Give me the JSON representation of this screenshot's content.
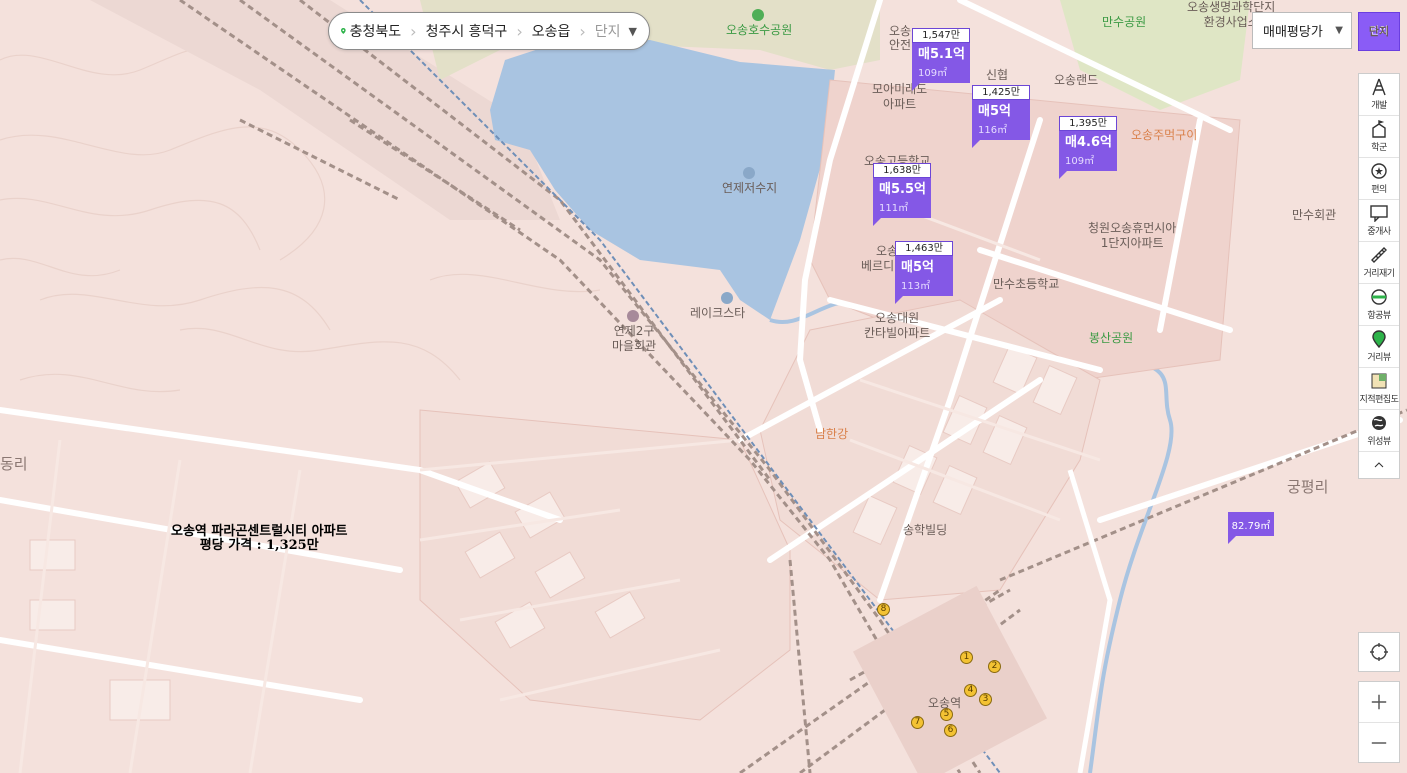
{
  "breadcrumb": {
    "items": [
      "충청북도",
      "청주시 흥덕구",
      "오송읍"
    ],
    "current": "단지"
  },
  "price_type_select": {
    "selected": "매매평당가"
  },
  "complex_button": {
    "top": "편의",
    "label": "단지"
  },
  "toolbar": [
    {
      "label": "개발",
      "icon": "development-icon"
    },
    {
      "label": "학군",
      "icon": "school-district-icon"
    },
    {
      "label": "편의",
      "icon": "convenience-icon"
    },
    {
      "label": "중개사",
      "icon": "realtor-icon"
    },
    {
      "label": "거리재기",
      "icon": "ruler-icon"
    },
    {
      "label": "항공뷰",
      "icon": "aerial-view-icon"
    },
    {
      "label": "거리뷰",
      "icon": "street-view-icon"
    },
    {
      "label": "지적편집도",
      "icon": "cadastral-map-icon"
    },
    {
      "label": "위성뷰",
      "icon": "satellite-view-icon"
    }
  ],
  "markers": [
    {
      "ppa": "1,547만",
      "price": "매5.1억",
      "area": "109㎡"
    },
    {
      "ppa": "1,425만",
      "price": "매5억",
      "area": "116㎡"
    },
    {
      "ppa": "1,395만",
      "price": "매4.6억",
      "area": "109㎡"
    },
    {
      "ppa": "1,638만",
      "price": "매5.5억",
      "area": "111㎡"
    },
    {
      "ppa": "1,463만",
      "price": "매5억",
      "area": "113㎡"
    }
  ],
  "small_marker": {
    "area": "82.79㎡"
  },
  "labels": {
    "osong_lake_park": "오송호수공원",
    "yeonje_reservoir": "연제저수지",
    "lakestar": "레이크스타",
    "yeonje2gu": "연제2구",
    "maeul_hall": "마을회관",
    "moa_1": "모아미래도",
    "moa_2": "아파트",
    "anjeon_frag": "안전",
    "osong_frag": "오송",
    "sinhyeop": "신협",
    "osong_land": "오송랜드",
    "hs_frag": "오송고등학교",
    "osong_ju": "오송주먹구이",
    "manshu_park": "만수공원",
    "manshu_hall": "만수회관",
    "saengmyeong_1": "오송생명과학단지",
    "saengmyeong_2": "환경사업소",
    "hueman_1": "청원오송휴먼시아",
    "hueman_2": "1단지아파트",
    "berdi_frag": "오송",
    "berdi_frag2": "베르디",
    "manshu_school": "만수초등학교",
    "bongsan_park": "봉산공원",
    "daewon_1": "오송대원",
    "daewon_2": "칸타빌아파트",
    "namhangang": "남한강",
    "songhak": "송학빌딩",
    "gungpyeong": "궁평리",
    "ri_left": "동리",
    "osong_station": "오송역"
  },
  "overlay_note": {
    "line1": "오송역 파라곤센트럴시티 아파트",
    "line2": "평당 가격 : 1,325만"
  },
  "station_exits": [
    "1",
    "2",
    "3",
    "4",
    "5",
    "6",
    "7",
    "8"
  ],
  "colors": {
    "marker": "#8458e6",
    "water": "#a9c4e1",
    "land": "#f4e1dc"
  }
}
